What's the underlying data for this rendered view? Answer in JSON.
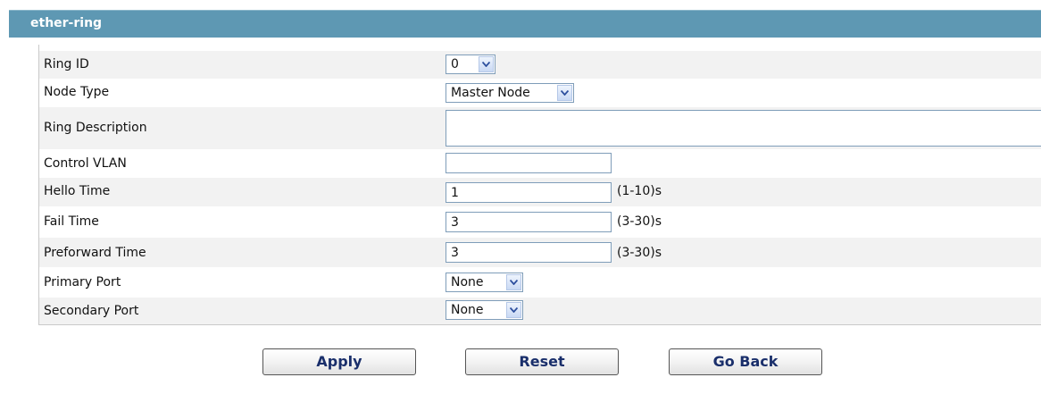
{
  "header": {
    "title": "ether-ring"
  },
  "form": {
    "ring_id": {
      "label": "Ring ID",
      "value": "0"
    },
    "node_type": {
      "label": "Node Type",
      "value": "Master Node"
    },
    "ring_description": {
      "label": "Ring Description",
      "value": ""
    },
    "control_vlan": {
      "label": "Control VLAN",
      "value": ""
    },
    "hello_time": {
      "label": "Hello Time",
      "value": "1",
      "range": "(1-10)s"
    },
    "fail_time": {
      "label": "Fail Time",
      "value": "3",
      "range": "(3-30)s"
    },
    "preforward_time": {
      "label": "Preforward Time",
      "value": "3",
      "range": "(3-30)s"
    },
    "primary_port": {
      "label": "Primary Port",
      "value": "None"
    },
    "secondary_port": {
      "label": "Secondary Port",
      "value": "None"
    }
  },
  "buttons": {
    "apply": "Apply",
    "reset": "Reset",
    "go_back": "Go Back"
  }
}
